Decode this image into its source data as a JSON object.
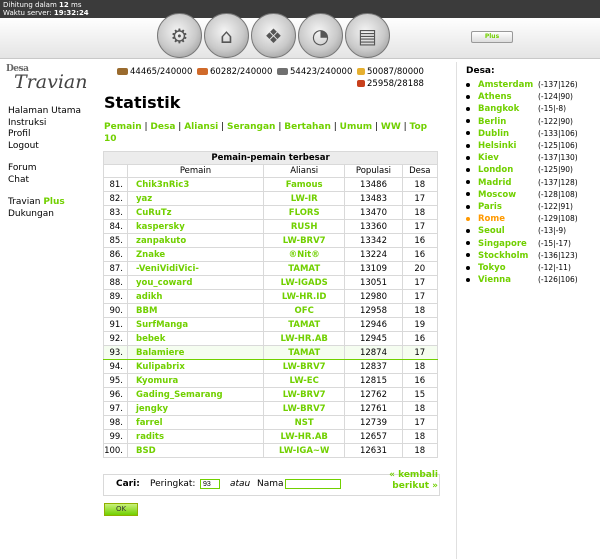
{
  "status": {
    "line1_label": "Dihitung dalam",
    "line1_value": "12",
    "line1_unit": "ms",
    "line2_label": "Waktu server:",
    "line2_value": "19:32:24"
  },
  "plus_button": "Plus",
  "logo": {
    "top": "Desa",
    "main": "Travian"
  },
  "menu": {
    "items1": [
      "Halaman Utama",
      "Instruksi",
      "Profil",
      "Logout"
    ],
    "items2": [
      "Forum",
      "Chat"
    ],
    "travian_plus_a": "Travian",
    "travian_plus_b": "Plus",
    "support": "Dukungan"
  },
  "resources": {
    "wood": "44465/240000",
    "clay": "60282/240000",
    "iron": "54423/240000",
    "crop": "50087/80000",
    "crop_use": "25958/28188"
  },
  "title": "Statistik",
  "subnav": [
    "Pemain",
    "Desa",
    "Aliansi",
    "Serangan",
    "Bertahan",
    "Umum",
    "WW",
    "Top 10"
  ],
  "table": {
    "caption": "Pemain-pemain terbesar",
    "headers": [
      "",
      "Pemain",
      "Aliansi",
      "Populasi",
      "Desa"
    ],
    "rows": [
      {
        "rank": "81.",
        "player": "Chik3nRic3",
        "alliance": "Famous",
        "pop": "13486",
        "villages": "18"
      },
      {
        "rank": "82.",
        "player": "yaz",
        "alliance": "LW-IR",
        "pop": "13483",
        "villages": "17"
      },
      {
        "rank": "83.",
        "player": "CuRuTz",
        "alliance": "FLORS",
        "pop": "13470",
        "villages": "18"
      },
      {
        "rank": "84.",
        "player": "kaspersky",
        "alliance": "RUSH",
        "pop": "13360",
        "villages": "17"
      },
      {
        "rank": "85.",
        "player": "zanpakuto",
        "alliance": "LW-BRV7",
        "pop": "13342",
        "villages": "16"
      },
      {
        "rank": "86.",
        "player": "Znake",
        "alliance": "®Nit®",
        "pop": "13224",
        "villages": "16"
      },
      {
        "rank": "87.",
        "player": "-VeniVidiVici-",
        "alliance": "TAMAT",
        "pop": "13109",
        "villages": "20"
      },
      {
        "rank": "88.",
        "player": "you_coward",
        "alliance": "LW-IGADS",
        "pop": "13051",
        "villages": "17"
      },
      {
        "rank": "89.",
        "player": "adikh",
        "alliance": "LW-HR.ID",
        "pop": "12980",
        "villages": "17"
      },
      {
        "rank": "90.",
        "player": "BBM",
        "alliance": "OFC",
        "pop": "12958",
        "villages": "18"
      },
      {
        "rank": "91.",
        "player": "SurfManga",
        "alliance": "TAMAT",
        "pop": "12946",
        "villages": "19"
      },
      {
        "rank": "92.",
        "player": "bebek",
        "alliance": "LW-HR.AB",
        "pop": "12945",
        "villages": "16"
      },
      {
        "rank": "93.",
        "player": "Balamiere",
        "alliance": "TAMAT",
        "pop": "12874",
        "villages": "17"
      },
      {
        "rank": "94.",
        "player": "Kulipabrix",
        "alliance": "LW-BRV7",
        "pop": "12837",
        "villages": "18"
      },
      {
        "rank": "95.",
        "player": "Kyomura",
        "alliance": "LW-EC",
        "pop": "12815",
        "villages": "16"
      },
      {
        "rank": "96.",
        "player": "Gading_Semarang",
        "alliance": "LW-BRV7",
        "pop": "12762",
        "villages": "15"
      },
      {
        "rank": "97.",
        "player": "jengky",
        "alliance": "LW-BRV7",
        "pop": "12761",
        "villages": "18"
      },
      {
        "rank": "98.",
        "player": "farrel",
        "alliance": "NST",
        "pop": "12739",
        "villages": "17"
      },
      {
        "rank": "99.",
        "player": "radits",
        "alliance": "LW-HR.AB",
        "pop": "12657",
        "villages": "18"
      },
      {
        "rank": "100.",
        "player": "BSD",
        "alliance": "LW-IGA~W",
        "pop": "12631",
        "villages": "18"
      }
    ]
  },
  "search": {
    "label": "Cari:",
    "rank_label": "Peringkat:",
    "rank_value": "93",
    "or_label": "atau",
    "name_label": "Nama",
    "name_value": "",
    "back_line1": "« kembali",
    "back_line2": "berikut »"
  },
  "ok_button": "OK",
  "villages": {
    "heading": "Desa:",
    "list": [
      {
        "name": "Amsterdam",
        "coords": "(-137|126)"
      },
      {
        "name": "Athens",
        "coords": "(-124|90)"
      },
      {
        "name": "Bangkok",
        "coords": "(-15|-8)"
      },
      {
        "name": "Berlin",
        "coords": "(-122|90)"
      },
      {
        "name": "Dublin",
        "coords": "(-133|106)"
      },
      {
        "name": "Helsinki",
        "coords": "(-125|106)"
      },
      {
        "name": "Kiev",
        "coords": "(-137|130)"
      },
      {
        "name": "London",
        "coords": "(-125|90)"
      },
      {
        "name": "Madrid",
        "coords": "(-137|128)"
      },
      {
        "name": "Moscow",
        "coords": "(-128|108)"
      },
      {
        "name": "Paris",
        "coords": "(-122|91)"
      },
      {
        "name": "Rome",
        "coords": "(-129|108)",
        "active": true
      },
      {
        "name": "Seoul",
        "coords": "(-13|-9)"
      },
      {
        "name": "Singapore",
        "coords": "(-15|-17)"
      },
      {
        "name": "Stockholm",
        "coords": "(-136|123)"
      },
      {
        "name": "Tokyo",
        "coords": "(-12|-11)"
      },
      {
        "name": "Vienna",
        "coords": "(-126|106)"
      }
    ]
  },
  "colors": {
    "accent": "#71d000",
    "active": "#ff9900"
  }
}
